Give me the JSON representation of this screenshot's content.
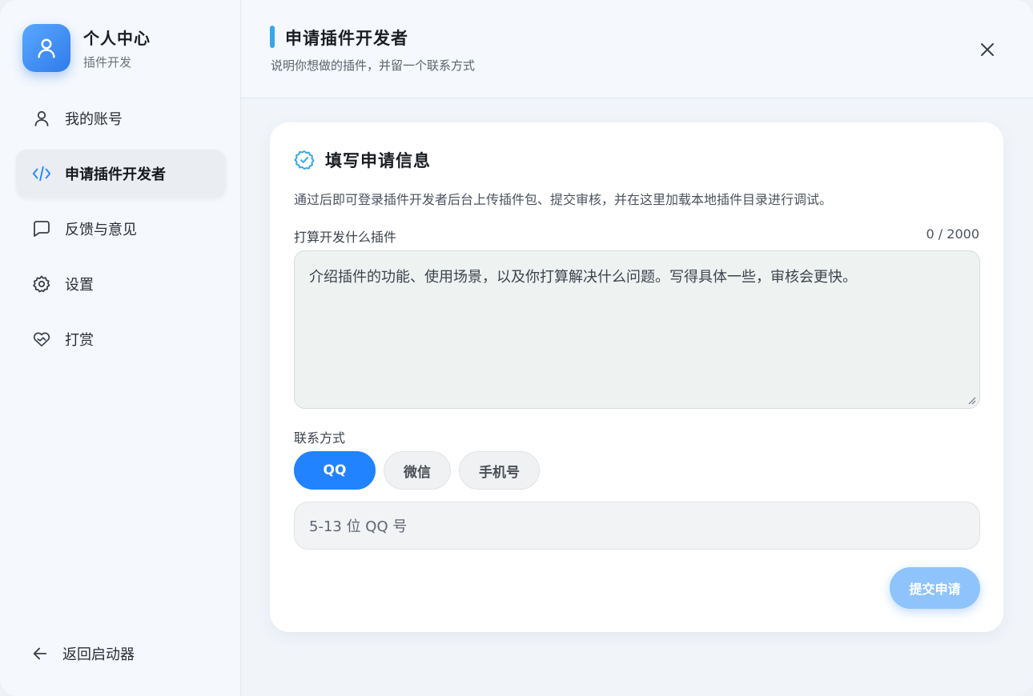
{
  "profile": {
    "title": "个人中心",
    "subtitle": "插件开发"
  },
  "sidebar": {
    "items": [
      {
        "label": "我的账号",
        "icon": "user-icon"
      },
      {
        "label": "申请插件开发者",
        "icon": "code-icon",
        "active": true
      },
      {
        "label": "反馈与意见",
        "icon": "message-icon"
      },
      {
        "label": "设置",
        "icon": "gear-icon"
      },
      {
        "label": "打赏",
        "icon": "heart-hand-icon"
      }
    ],
    "back_label": "返回启动器"
  },
  "header": {
    "title": "申请插件开发者",
    "subtitle": "说明你想做的插件，并留一个联系方式"
  },
  "form": {
    "title": "填写申请信息",
    "description": "通过后即可登录插件开发者后台上传插件包、提交审核，并在这里加载本地插件目录进行调试。",
    "plugin_label": "打算开发什么插件",
    "counter": "0 / 2000",
    "plugin_placeholder": "介绍插件的功能、使用场景，以及你打算解决什么问题。写得具体一些，审核会更快。",
    "contact_label": "联系方式",
    "contact_options": [
      "QQ",
      "微信",
      "手机号"
    ],
    "contact_selected": "QQ",
    "contact_placeholder": "5-13 位 QQ 号",
    "submit_label": "提交申请"
  },
  "colors": {
    "accent": "#2183ff",
    "header_bar": "#3aa6e8",
    "submit_disabled": "#8ec4fb"
  }
}
